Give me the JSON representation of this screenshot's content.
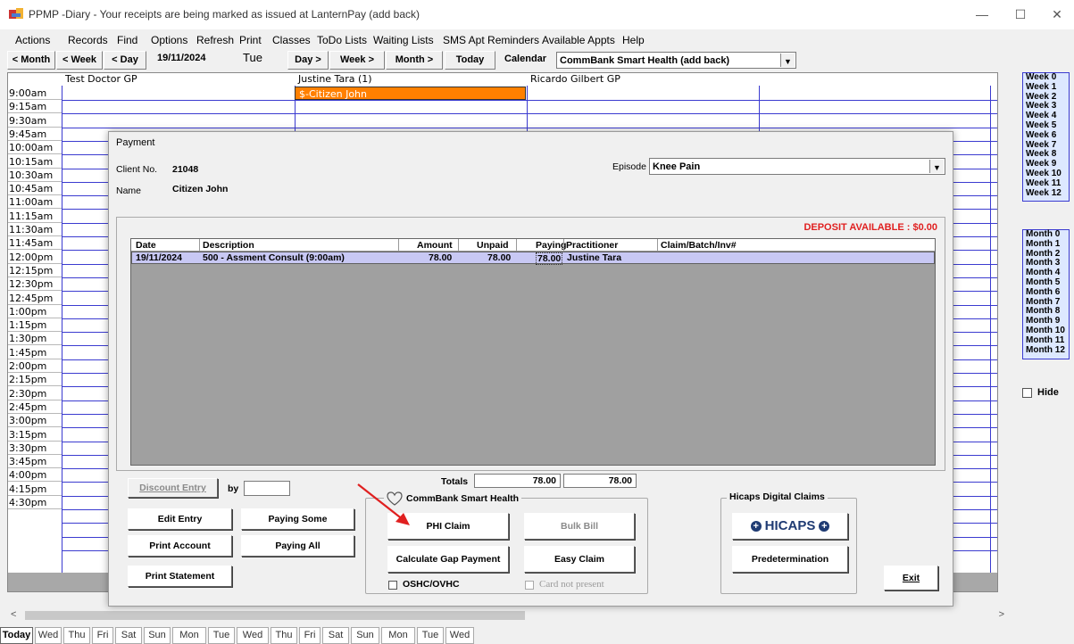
{
  "window": {
    "title": "PPMP -Diary - Your receipts are being marked as issued at LanternPay (add back)"
  },
  "menu": [
    "Actions",
    "Records",
    "Find",
    "Options",
    "Refresh",
    "Print",
    "Classes",
    "ToDo Lists",
    "Waiting Lists",
    "SMS Apt Reminders",
    "Available Appts",
    "Help"
  ],
  "toolbar": {
    "prev_month": "< Month",
    "prev_week": "< Week",
    "prev_day": "< Day",
    "date": "19/11/2024",
    "weekday": "Tue",
    "next_day": "Day >",
    "next_week": "Week >",
    "next_month": "Month >",
    "today": "Today",
    "calendar_label": "Calendar",
    "calendar_value": "CommBank Smart Health (add back)"
  },
  "diary": {
    "columns": [
      "Test Doctor GP",
      "Justine Tara  (1)",
      "Ricardo Gilbert GP"
    ],
    "times": [
      "9:00am",
      "9:15am",
      "9:30am",
      "9:45am",
      "10:00am",
      "10:15am",
      "10:30am",
      "10:45am",
      "11:00am",
      "11:15am",
      "11:30am",
      "11:45am",
      "12:00pm",
      "12:15pm",
      "12:30pm",
      "12:45pm",
      "1:00pm",
      "1:15pm",
      "1:30pm",
      "1:45pm",
      "2:00pm",
      "2:15pm",
      "2:30pm",
      "2:45pm",
      "3:00pm",
      "3:15pm",
      "3:30pm",
      "3:45pm",
      "4:00pm",
      "4:15pm",
      "4:30pm"
    ],
    "appointment": "$-Citizen John",
    "appointment_color": "#ff8000"
  },
  "weeks": [
    "Week 0",
    "Week 1",
    "Week 2",
    "Week 3",
    "Week 4",
    "Week 5",
    "Week 6",
    "Week 7",
    "Week 8",
    "Week 9",
    "Week 10",
    "Week 11",
    "Week 12"
  ],
  "months": [
    "Month 0",
    "Month 1",
    "Month 2",
    "Month 3",
    "Month 4",
    "Month 5",
    "Month 6",
    "Month 7",
    "Month 8",
    "Month 9",
    "Month 10",
    "Month 11",
    "Month 12"
  ],
  "hide_label": "Hide",
  "day_tabs": [
    "Today",
    "Wed",
    "Thu",
    "Fri",
    "Sat",
    "Sun",
    "Mon",
    "Tue",
    "Wed",
    "Thu",
    "Fri",
    "Sat",
    "Sun",
    "Mon",
    "Tue",
    "Wed"
  ],
  "payment": {
    "title": "Payment",
    "client_no_label": "Client No.",
    "client_no": "21048",
    "name_label": "Name",
    "name": "Citizen John",
    "episode_label": "Episode",
    "episode": "Knee Pain",
    "deposit": "DEPOSIT AVAILABLE :  $0.00",
    "columns": {
      "date": "Date",
      "description": "Description",
      "amount": "Amount",
      "unpaid": "Unpaid",
      "paying": "Paying",
      "practitioner": "Practitioner",
      "claim": "Claim/Batch/Inv#"
    },
    "row": {
      "date": "19/11/2024",
      "description": "500 - Assment Consult  (9:00am)",
      "amount": "78.00",
      "unpaid": "78.00",
      "paying": "78.00",
      "practitioner": "Justine Tara",
      "claim": ""
    },
    "totals_label": "Totals",
    "total_unpaid": "78.00",
    "total_paying": "78.00",
    "discount_entry": "Discount Entry",
    "by_label": "by",
    "edit_entry": "Edit Entry",
    "paying_some": "Paying Some",
    "print_account": "Print Account",
    "paying_all": "Paying All",
    "print_statement": "Print Statement",
    "csh_group": "CommBank Smart Health",
    "phi_claim": "PHI Claim",
    "bulk_bill": "Bulk Bill",
    "calc_gap": "Calculate Gap Payment",
    "easy_claim": "Easy Claim",
    "oshc": "OSHC/OVHC",
    "card_not_present": "Card not present",
    "hicaps_group": "Hicaps Digital Claims",
    "hicaps_logo": "HICAPS",
    "predetermination": "Predetermination",
    "exit": "Exit",
    "arrow_color": "#e02020"
  }
}
